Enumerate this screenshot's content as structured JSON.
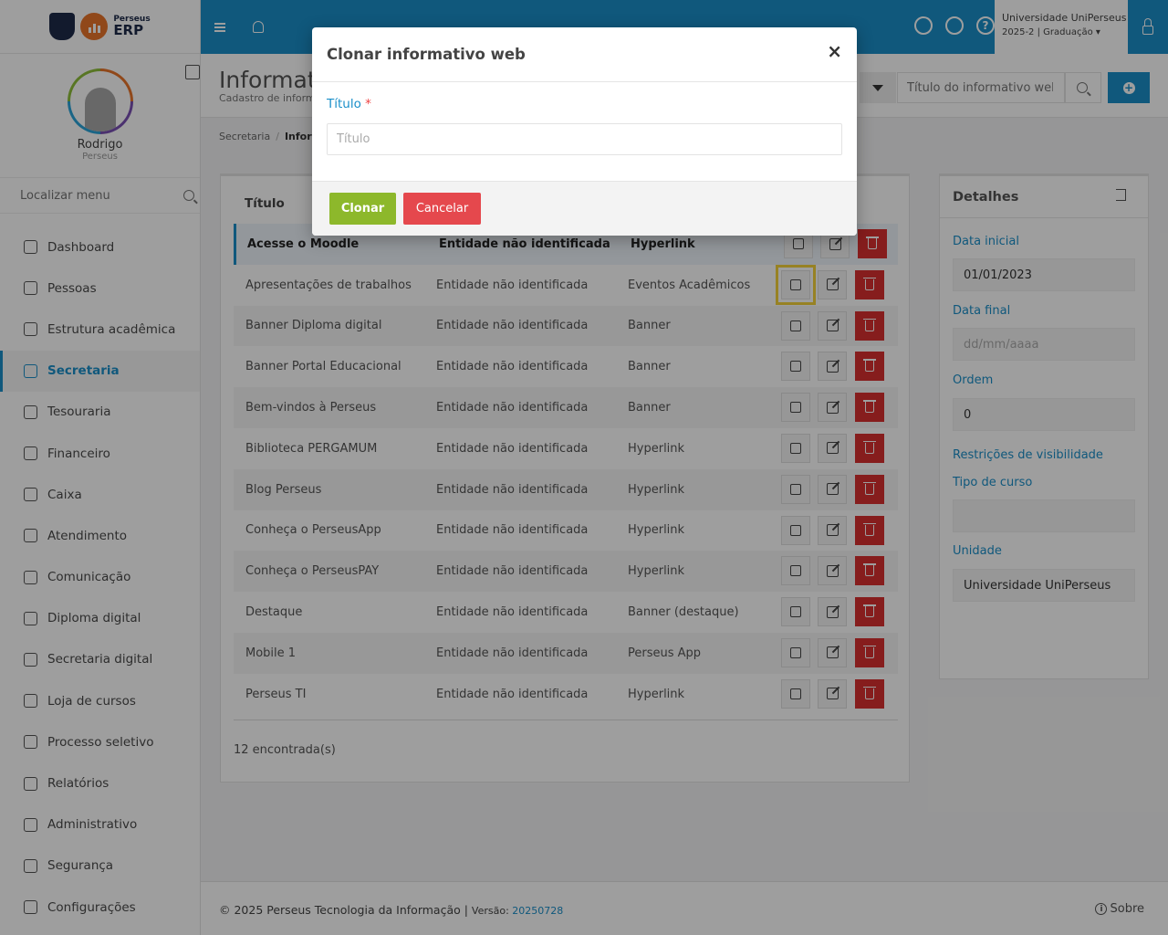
{
  "logo": {
    "brand_small": "Perseus",
    "brand_big": "ERP"
  },
  "profile": {
    "name": "Rodrigo",
    "org": "Perseus"
  },
  "menu_search": {
    "placeholder": "Localizar menu"
  },
  "nav": [
    {
      "label": "Dashboard",
      "icon": "chart-icon",
      "active": false
    },
    {
      "label": "Pessoas",
      "icon": "people-icon",
      "active": false
    },
    {
      "label": "Estrutura acadêmica",
      "icon": "layers-icon",
      "active": false
    },
    {
      "label": "Secretaria",
      "icon": "graduation-cap-icon",
      "active": true
    },
    {
      "label": "Tesouraria",
      "icon": "calculator-icon",
      "active": false
    },
    {
      "label": "Financeiro",
      "icon": "credit-card-icon",
      "active": false
    },
    {
      "label": "Caixa",
      "icon": "inbox-icon",
      "active": false
    },
    {
      "label": "Atendimento",
      "icon": "chat-icon",
      "active": false
    },
    {
      "label": "Comunicação",
      "icon": "envelope-icon",
      "active": false
    },
    {
      "label": "Diploma digital",
      "icon": "book-icon",
      "active": false
    },
    {
      "label": "Secretaria digital",
      "icon": "award-icon",
      "active": false
    },
    {
      "label": "Loja de cursos",
      "icon": "cart-icon",
      "active": false
    },
    {
      "label": "Processo seletivo",
      "icon": "phone-icon",
      "active": false
    },
    {
      "label": "Relatórios",
      "icon": "printer-icon",
      "active": false
    },
    {
      "label": "Administrativo",
      "icon": "gear-icon",
      "active": false
    },
    {
      "label": "Segurança",
      "icon": "lock-icon",
      "active": false
    },
    {
      "label": "Configurações",
      "icon": "settings-icon",
      "active": false
    }
  ],
  "topbar": {
    "institution": "Universidade UniPerseus",
    "period": "2025-2 | Graduação",
    "help_glyph": "?"
  },
  "page": {
    "title": "Informativo",
    "subtitle": "Cadastro de informa",
    "search_placeholder": "Título do informativo web",
    "add_glyph": "+"
  },
  "breadcrumb": {
    "parent": "Secretaria",
    "separator": "/",
    "current": "Inform"
  },
  "table": {
    "header_title": "Título",
    "rows": [
      {
        "title": "Acesse o Moodle",
        "entity": "Entidade não identificada",
        "type": "Hyperlink",
        "selected": true
      },
      {
        "title": "Apresentações de trabalhos",
        "entity": "Entidade não identificada",
        "type": "Eventos Acadêmicos",
        "highlight": true
      },
      {
        "title": "Banner Diploma digital",
        "entity": "Entidade não identificada",
        "type": "Banner"
      },
      {
        "title": "Banner Portal Educacional",
        "entity": "Entidade não identificada",
        "type": "Banner"
      },
      {
        "title": "Bem-vindos à Perseus",
        "entity": "Entidade não identificada",
        "type": "Banner"
      },
      {
        "title": "Biblioteca PERGAMUM",
        "entity": "Entidade não identificada",
        "type": "Hyperlink"
      },
      {
        "title": "Blog Perseus",
        "entity": "Entidade não identificada",
        "type": "Hyperlink"
      },
      {
        "title": "Conheça o PerseusApp",
        "entity": "Entidade não identificada",
        "type": "Hyperlink"
      },
      {
        "title": "Conheça o PerseusPAY",
        "entity": "Entidade não identificada",
        "type": "Hyperlink"
      },
      {
        "title": "Destaque",
        "entity": "Entidade não identificada",
        "type": "Banner (destaque)"
      },
      {
        "title": "Mobile 1",
        "entity": "Entidade não identificada",
        "type": "Perseus App"
      },
      {
        "title": "Perseus TI",
        "entity": "Entidade não identificada",
        "type": "Hyperlink"
      }
    ],
    "count_text": "12 encontrada(s)"
  },
  "details": {
    "title": "Detalhes",
    "data_inicial_label": "Data inicial",
    "data_inicial_value": "01/01/2023",
    "data_final_label": "Data final",
    "data_final_placeholder": "dd/mm/aaaa",
    "ordem_label": "Ordem",
    "ordem_value": "0",
    "restricoes_label": "Restrições de visibilidade",
    "tipo_curso_label": "Tipo de curso",
    "tipo_curso_value": "",
    "unidade_label": "Unidade",
    "unidade_value": "Universidade UniPerseus"
  },
  "footer": {
    "copyright": "© 2025 Perseus Tecnologia da Informação | ",
    "version_label": "Versão: ",
    "version": "20250728",
    "about": "Sobre",
    "info_glyph": "i"
  },
  "modal": {
    "title": "Clonar informativo web",
    "close_glyph": "×",
    "field_label": "Título",
    "required_mark": "*",
    "field_placeholder": "Título",
    "field_value": "",
    "clone_button": "Clonar",
    "cancel_button": "Cancelar"
  },
  "colors": {
    "primary": "#1a8fc9",
    "success": "#8db82b",
    "danger": "#e5484d",
    "delete": "#d9302f",
    "highlight": "#f4d23a"
  }
}
